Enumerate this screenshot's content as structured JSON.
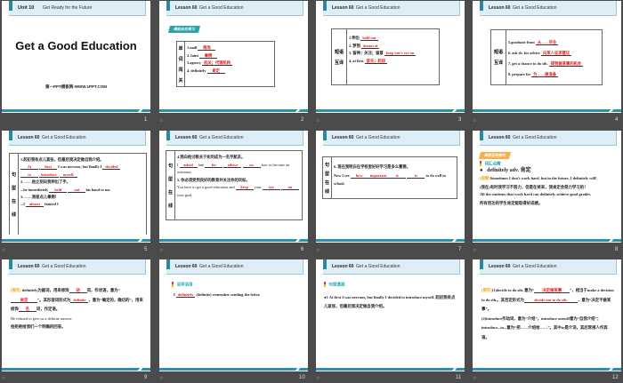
{
  "header": {
    "lesson": "Lesson 60",
    "topic": "Get a Good Education"
  },
  "colors": {
    "background": "#4b4b4b",
    "accent_teal": "#2c8fac",
    "answer_red": "#e8191b",
    "tag_orange": "#f0a818"
  },
  "slide_numbers": [
    "1",
    "2",
    "3",
    "4",
    "5",
    "6",
    "7",
    "8",
    "9",
    "10",
    "11",
    "12"
  ],
  "transition_icon": "star-transition-icon",
  "s1": {
    "unit": "Unit 10",
    "unit_title": "Get Ready for the Future",
    "title": "Get a Good Education",
    "site": "第一PPT模板网-WWW.1PPT.COM"
  },
  "s2": {
    "badge": "课前自主预习",
    "side": [
      "单",
      "词",
      "闯",
      "关"
    ],
    "rows": [
      {
        "q": "1.mall",
        "a": "商场"
      },
      {
        "q": "2. faint",
        "a": "晕倒"
      },
      {
        "q": "3.agency",
        "a": "机关；代理机构"
      },
      {
        "q": "4. definitely",
        "a": "肯定"
      }
    ]
  },
  "s3": {
    "side": [
      "短语",
      "互译"
    ],
    "rows": [
      {
        "q": "1.伸出",
        "a": "hold out"
      },
      {
        "q": "2. 梦到",
        "a": "dream of"
      },
      {
        "q": "3. 留神；关注；留意",
        "a": "keep one's eye on"
      },
      {
        "q": "4. at first",
        "a": "首先；起初"
      }
    ]
  },
  "s4": {
    "side": [
      "短语",
      "互译"
    ],
    "rows": [
      {
        "q": "5.graduate from",
        "a": "从……毕业"
      },
      {
        "q": "6. ask sb. for advice",
        "a": "向某人征求建议"
      },
      {
        "q": "7. get a chance to do sth.",
        "a": "得到做某事的机会"
      },
      {
        "q": "8. prepare for",
        "a": "为……做准备"
      }
    ]
  },
  "s5": {
    "side": [
      "句",
      "型",
      "在",
      "线"
    ],
    "l1": "1.起初我有点儿紧张，但最后我决定做自我介绍。",
    "a1": "At",
    "a2": "first",
    "t1": "I was nervous, but finally I",
    "a3": "decided",
    "a4": "to",
    "a5": "introduce",
    "a6": "myself",
    "l2": "2. ……他立刻向我伸出了手。",
    "t2a": "...he immediately",
    "a7": "held",
    "a8": "out",
    "t2b": "his hand to me.",
    "l3": "3. ……我差点儿晕倒！",
    "t3a": "...I",
    "a9": "almost",
    "t3b": "fainted I"
  },
  "s6": {
    "side": [
      "句",
      "型",
      "在",
      "线"
    ],
    "l4": "4.我向他讨教关于如何成为一名宇航员。",
    "t4a": "I",
    "a1": "asked",
    "t4b": "him",
    "a2": "for",
    "a3": "advice",
    "a4": "on",
    "t4c": "how to become an astronaut.",
    "l5": "5. 你必须受到良好的教育并关注你的目标。",
    "t5a": "You have to get a good education and",
    "a5": "keep",
    "t5b": "your",
    "a6": "eye",
    "a7": "on",
    "t5c": "your goal."
  },
  "s7": {
    "side": [
      "句",
      "型",
      "在",
      "线"
    ],
    "l6": "6. 现在我明白在学校里好好学习是多么重要。",
    "t6a": "Now I see",
    "a1": "how",
    "a2": "important",
    "a3": "it",
    "a4": "is",
    "t6b": "to do well in school."
  },
  "s8": {
    "badge": "课堂互动探究",
    "sub": "词汇点睛",
    "word": "definitely adv. 肯定",
    "tag": "[观察]",
    "ex1": "Sometimes I don't work hard, but in the future, I definitely will!",
    "cn1": "(我在)有时我学习不努力，但是在将来，我肯定会努力学习的！",
    "ex2": "All the students that work hard can definitely achieve good grades.",
    "cn2": "所有用功的学生肯定能取得好成绩。"
  },
  "s9": {
    "tag": "[探究]",
    "p1": "definitely为副词，用来修饰",
    "a1": "动",
    "p2": "词，作状语，意为“",
    "a2": "肯定",
    "p3": "”。其形容词形式为",
    "a3": "definite",
    "p4": "，意为“确定的，确切的”，用来修饰",
    "a4": "名",
    "p5": "词，作定语。",
    "ex": "He refused to give us a definite answer.",
    "cn": "他拒绝给我们一个明确的回答。"
  },
  "s10": {
    "sub": "活学活用",
    "t1": "I",
    "a1": "definitely",
    "t2": "(definite) remember  sending the letter."
  },
  "s11": {
    "sub": "句型透视",
    "text": "●1 At first I was nervous, but finally I decided to introduce myself. 起初我有点儿紧张，但最后我决定做自我介绍。"
  },
  "s12": {
    "tag": "[探究]",
    "p1": "(1)decide to do sth. 意为“",
    "a1": "决定做某事",
    "p2": "”，相当于make a decision to do sth.。其否定形式为",
    "a2": "decide not to do sth.",
    "p3": "，意为“决定不做某事”。",
    "p4": "(2)introduce作动词，意为“介绍”，introduce oneself意为“自我介绍”；introduce...to...意为“把……介绍给……”。其中to是介词，其后常接人作宾语。"
  }
}
